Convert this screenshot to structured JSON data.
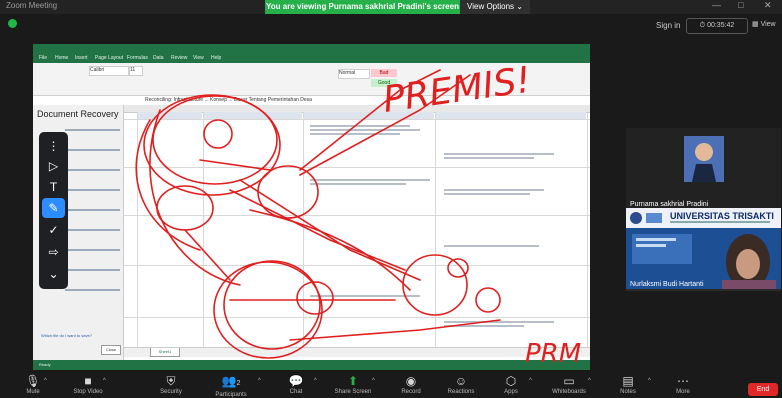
{
  "window": {
    "title": "Zoom Meeting",
    "minimize": "—",
    "maximize": "□",
    "close": "✕"
  },
  "banner": {
    "viewing_text": "You are viewing Purnama sakhrial Pradini's screen",
    "view_options": "View Options",
    "view_options_caret": "⌄"
  },
  "top_right": {
    "sign_in": "Sign in",
    "timer": "00:35:42",
    "view_label": "View"
  },
  "excel": {
    "formula_text": "Reconciling: Infrastructure ... Konsep ... Dasar Tentang Pemerintahan Desa",
    "tabs": [
      "File",
      "Home",
      "Insert",
      "Page Layout",
      "Formulas",
      "Data",
      "Review",
      "View",
      "Help"
    ],
    "font_name": "Calibri",
    "font_size": "11",
    "style_bad": "Bad",
    "style_good": "Good",
    "normal": "Normal",
    "recovery_title": "Document Recovery",
    "recovery_link": "Which file do I want to save?",
    "close_label": "Close",
    "sheet_tab": "Sheet1",
    "status": "Ready"
  },
  "annotation": {
    "text_premis": "PREMIS!",
    "text_prm": "PRM",
    "color": "#e01f1f"
  },
  "annotate_tools": [
    "pointer-arrow",
    "spotlight-arrow",
    "text",
    "draw",
    "stamp",
    "eraser",
    "more"
  ],
  "participants": [
    {
      "name": "Purnama sakhrial Pradini"
    },
    {
      "name": "Nurlaksmi Budi Hartanti",
      "banner_title": "UNIVERSITAS TRISAKTI"
    }
  ],
  "footer": {
    "buttons": [
      {
        "label": "Mute"
      },
      {
        "label": "Stop Video"
      },
      {
        "label": "Security"
      },
      {
        "label": "Participants",
        "count": "2"
      },
      {
        "label": "Chat"
      },
      {
        "label": "Share Screen"
      },
      {
        "label": "Record"
      },
      {
        "label": "Reactions"
      },
      {
        "label": "Apps"
      },
      {
        "label": "Whiteboards"
      },
      {
        "label": "Notes"
      },
      {
        "label": "More"
      }
    ],
    "end": "End"
  },
  "colors": {
    "accent_green": "#25b04a",
    "excel_green": "#217346",
    "end_red": "#e02828",
    "zoom_blue": "#2d8cff"
  }
}
